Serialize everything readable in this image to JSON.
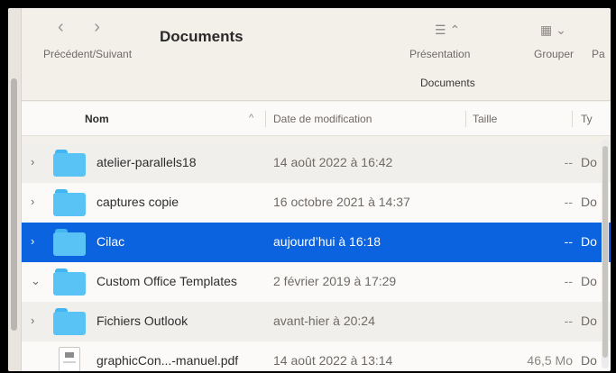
{
  "toolbar": {
    "nav_arrows": "‹  ›",
    "nav_label": "Précédent/Suivant",
    "title": "Documents",
    "presentation_label": "Présentation",
    "group_label": "Grouper",
    "more_label": "Pa",
    "path_title": "Documents"
  },
  "columns": {
    "name": "Nom",
    "date": "Date de modification",
    "size": "Taille",
    "kind": "Ty"
  },
  "rows": [
    {
      "name": "atelier-parallels18",
      "date": "14 août 2022 à 16:42",
      "size": "--",
      "kind": "Do",
      "disclosure": "›"
    },
    {
      "name": "captures copie",
      "date": "16 octobre 2021 à 14:37",
      "size": "--",
      "kind": "Do",
      "disclosure": "›"
    },
    {
      "name": "Cilac",
      "date": "aujourd’hui à 16:18",
      "size": "--",
      "kind": "Do",
      "disclosure": "›"
    },
    {
      "name": "Custom Office Templates",
      "date": "2 février 2019 à 17:29",
      "size": "--",
      "kind": "Do",
      "disclosure": "⌄"
    },
    {
      "name": "Fichiers Outlook",
      "date": "avant-hier à 20:24",
      "size": "--",
      "kind": "Do",
      "disclosure": "›"
    },
    {
      "name": "graphicCon...-manuel.pdf",
      "date": "14 août 2022 à 13:14",
      "size": "46,5 Mo",
      "kind": "Do"
    }
  ],
  "colors": {
    "selection": "#0b63df",
    "folder": "#59c3f6"
  },
  "icons": {
    "presentation": "list-view-icon",
    "group": "grid-group-icon",
    "folder": "folder-icon",
    "pdf": "pdf-file-icon"
  }
}
